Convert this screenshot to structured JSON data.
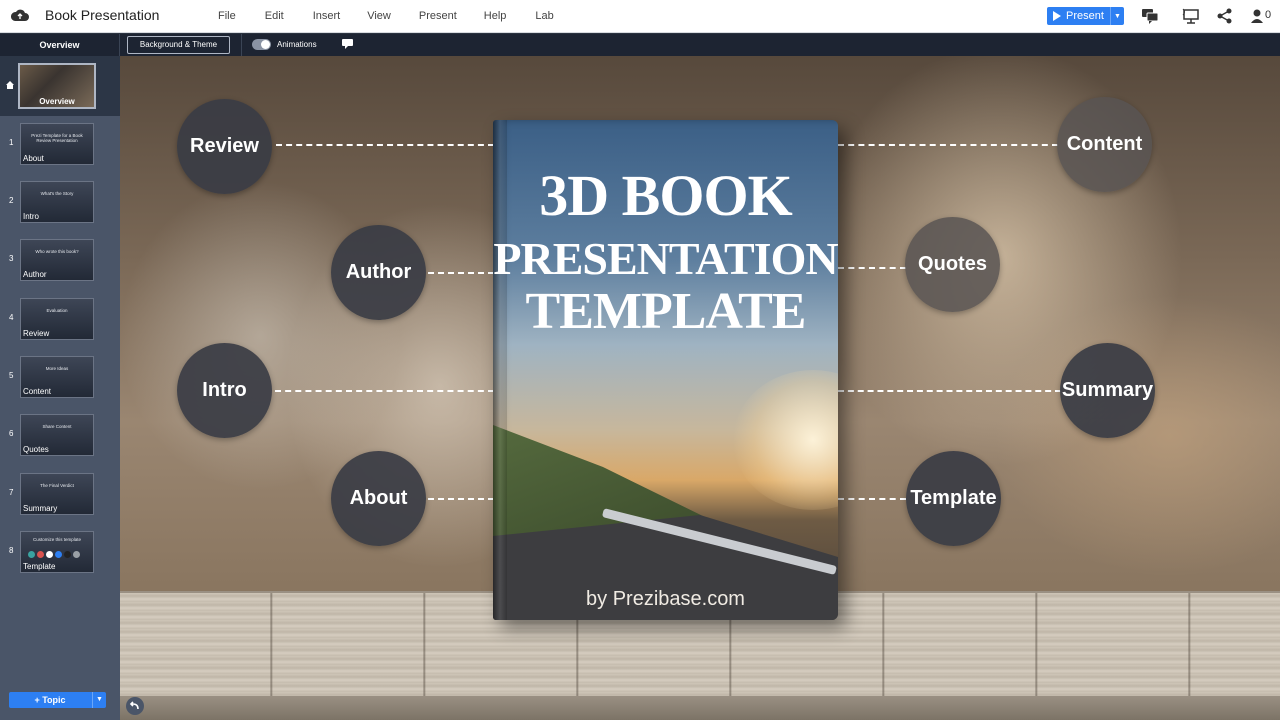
{
  "app": {
    "title": "Book Presentation",
    "menu": [
      "File",
      "Edit",
      "Insert",
      "View",
      "Present",
      "Help",
      "Lab"
    ],
    "present_label": "Present",
    "collaborator_count": "0"
  },
  "subbar": {
    "overview_label": "Overview",
    "bg_theme_label": "Background & Theme",
    "animations_label": "Animations"
  },
  "sidebar": {
    "overview_thumb_label": "Overview",
    "slides": [
      {
        "num": "1",
        "thumb_text": "Prezi Template for a Book Review Presentation",
        "label": "About"
      },
      {
        "num": "2",
        "thumb_text": "What's the Story",
        "label": "Intro"
      },
      {
        "num": "3",
        "thumb_text": "Who wrote this book?",
        "label": "Author"
      },
      {
        "num": "4",
        "thumb_text": "Evaluation",
        "label": "Review"
      },
      {
        "num": "5",
        "thumb_text": "More Ideas",
        "label": "Content"
      },
      {
        "num": "6",
        "thumb_text": "Share Content",
        "label": "Quotes"
      },
      {
        "num": "7",
        "thumb_text": "The Final Verdict",
        "label": "Summary"
      },
      {
        "num": "8",
        "thumb_text": "Customize this template",
        "label": "Template"
      }
    ],
    "template_swatches": [
      "#3aa3a0",
      "#d9534f",
      "#ffffff",
      "#2d7ff2",
      "#222222",
      "#9aa0a6"
    ],
    "topic_button": "+ Topic"
  },
  "canvas": {
    "book": {
      "title_line1": "3D BOOK",
      "title_line2": "PRESENTATION",
      "title_line3": "TEMPLATE",
      "byline": "by Prezibase.com"
    },
    "topics_left": [
      {
        "label": "Review"
      },
      {
        "label": "Author"
      },
      {
        "label": "Intro"
      },
      {
        "label": "About"
      }
    ],
    "topics_right": [
      {
        "label": "Content"
      },
      {
        "label": "Quotes"
      },
      {
        "label": "Summary"
      },
      {
        "label": "Template"
      }
    ]
  }
}
